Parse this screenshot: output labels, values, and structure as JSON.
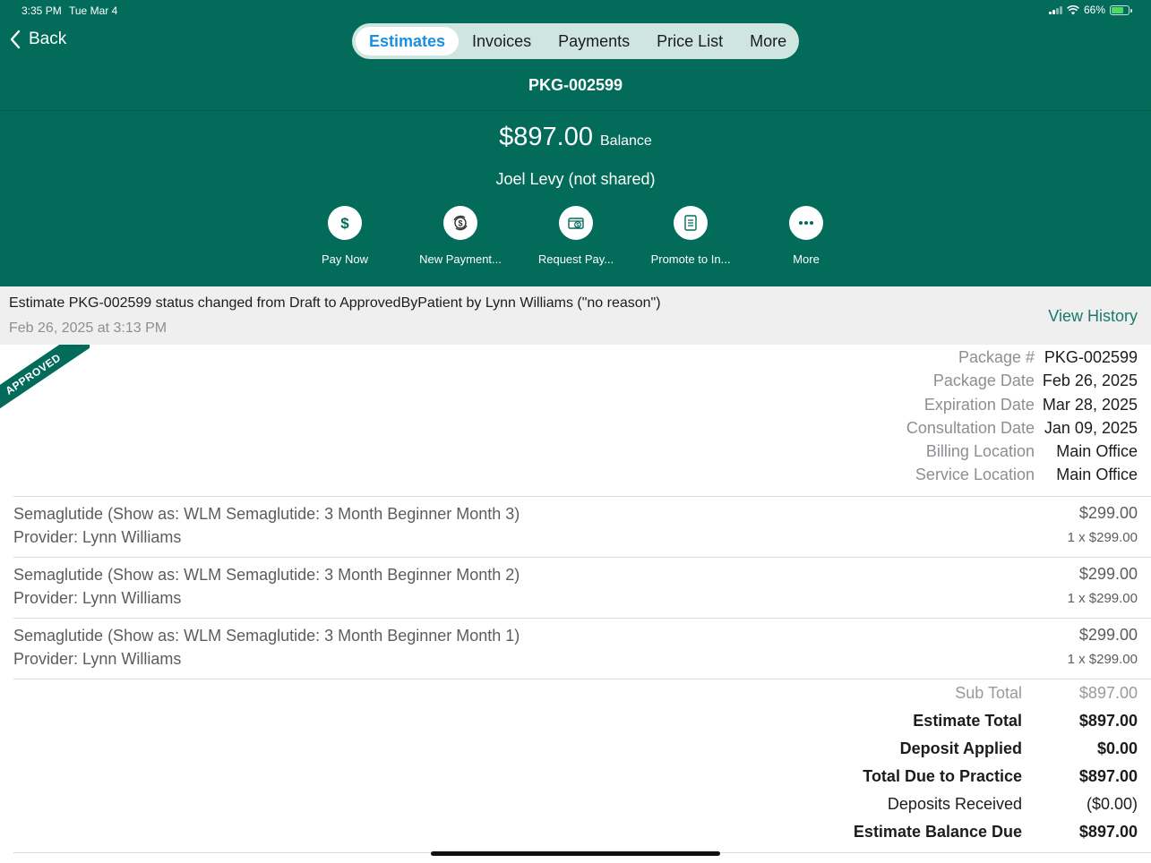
{
  "status_bar": {
    "time": "3:35 PM",
    "date": "Tue Mar 4",
    "battery": "66%"
  },
  "nav": {
    "back_label": "Back",
    "tabs": [
      {
        "label": "Estimates",
        "active": true
      },
      {
        "label": "Invoices",
        "active": false
      },
      {
        "label": "Payments",
        "active": false
      },
      {
        "label": "Price List",
        "active": false
      },
      {
        "label": "More",
        "active": false
      }
    ]
  },
  "header": {
    "package_title": "PKG-002599",
    "balance_amount": "$897.00",
    "balance_label": "Balance",
    "patient": "Joel Levy (not shared)",
    "actions": [
      {
        "label": "Pay Now",
        "icon": "dollar-icon"
      },
      {
        "label": "New Payment...",
        "icon": "payment-plan-icon"
      },
      {
        "label": "Request Pay...",
        "icon": "request-payment-icon"
      },
      {
        "label": "Promote to In...",
        "icon": "invoice-icon"
      },
      {
        "label": "More",
        "icon": "ellipsis-icon"
      }
    ]
  },
  "notice": {
    "text": "Estimate PKG-002599 status changed from Draft to ApprovedByPatient by Lynn Williams (\"no reason\")",
    "date": "Feb 26, 2025 at 3:13 PM",
    "view_history": "View History"
  },
  "ribbon": "APPROVED",
  "info": [
    {
      "key": "Package #",
      "value": "PKG-002599"
    },
    {
      "key": "Package Date",
      "value": "Feb 26, 2025"
    },
    {
      "key": "Expiration Date",
      "value": "Mar 28, 2025"
    },
    {
      "key": "Consultation Date",
      "value": "Jan 09, 2025"
    },
    {
      "key": "Billing Location",
      "value": "Main Office"
    },
    {
      "key": "Service Location",
      "value": "Main Office"
    }
  ],
  "line_items": [
    {
      "name": "Semaglutide (Show as: WLM Semaglutide: 3 Month Beginner Month 3)",
      "provider": "Provider: Lynn Williams",
      "total": "$299.00",
      "qty": "1 x $299.00"
    },
    {
      "name": "Semaglutide (Show as: WLM Semaglutide: 3 Month Beginner Month 2)",
      "provider": "Provider: Lynn Williams",
      "total": "$299.00",
      "qty": "1 x $299.00"
    },
    {
      "name": "Semaglutide (Show as: WLM Semaglutide: 3 Month Beginner Month 1)",
      "provider": "Provider: Lynn Williams",
      "total": "$299.00",
      "qty": "1 x $299.00"
    }
  ],
  "totals": [
    {
      "label": "Sub Total",
      "value": "$897.00",
      "style": "muted"
    },
    {
      "label": "Estimate Total",
      "value": "$897.00",
      "style": "bold"
    },
    {
      "label": "Deposit Applied",
      "value": "$0.00",
      "style": "bold"
    },
    {
      "label": "Total Due to Practice",
      "value": "$897.00",
      "style": "bold"
    },
    {
      "label": "Deposits Received",
      "value": "($0.00)",
      "style": "normal"
    },
    {
      "label": "Estimate Balance Due",
      "value": "$897.00",
      "style": "bold"
    }
  ],
  "colors": {
    "header_bg": "#026b5a",
    "active_tab_text": "#1a8fe0",
    "link": "#1a7a6a"
  }
}
